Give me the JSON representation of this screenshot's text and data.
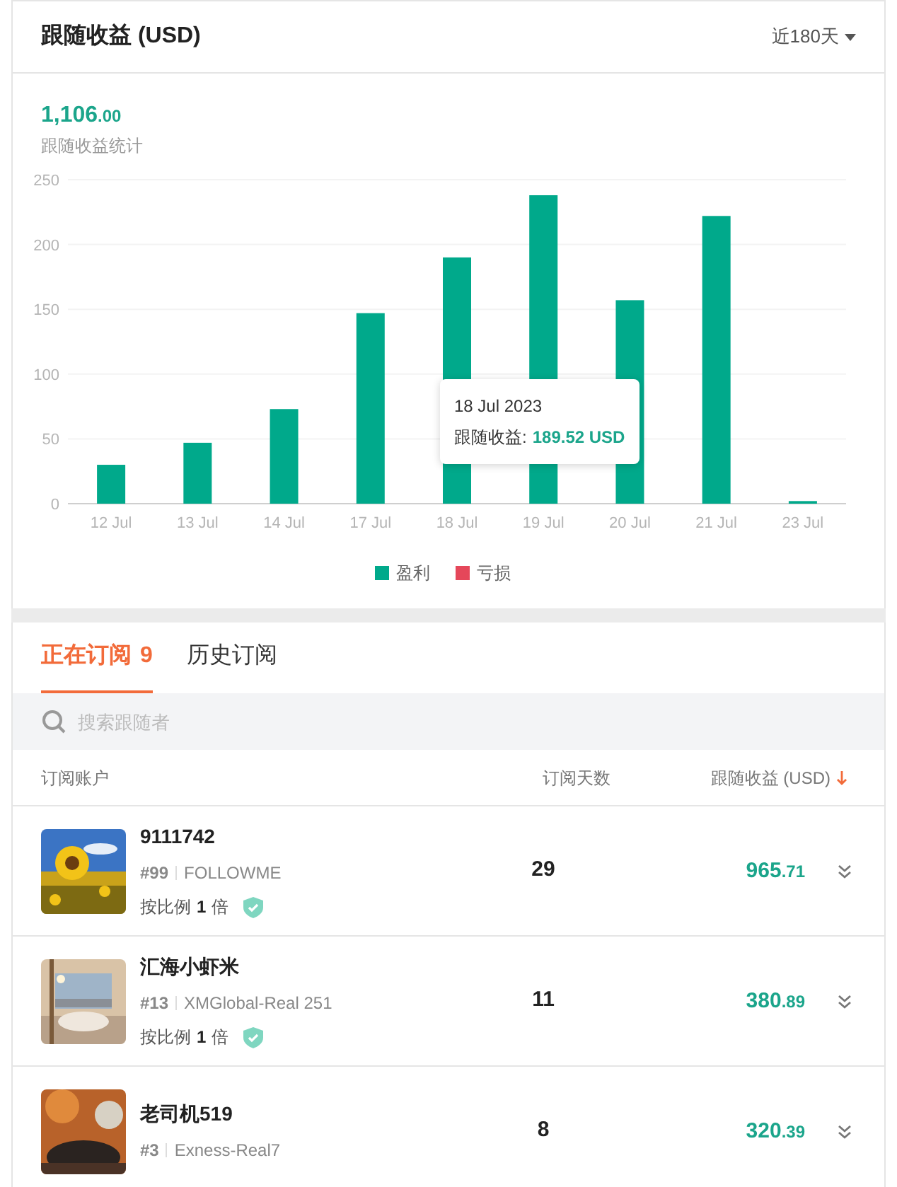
{
  "header": {
    "title": "跟随收益 (USD)",
    "period": "近180天"
  },
  "summary": {
    "total": "1,106.00",
    "label": "跟随收益统计"
  },
  "chart_data": {
    "type": "bar",
    "categories": [
      "12 Jul",
      "13 Jul",
      "14 Jul",
      "17 Jul",
      "18 Jul",
      "19 Jul",
      "20 Jul",
      "21 Jul",
      "23 Jul"
    ],
    "yticks": [
      0,
      50,
      100,
      150,
      200,
      250
    ],
    "ylim": [
      0,
      250
    ],
    "grid": true,
    "series": [
      {
        "name": "盈利",
        "color": "#00a98b",
        "values": [
          30,
          47,
          73,
          147,
          190,
          238,
          157,
          222,
          2
        ]
      },
      {
        "name": "亏损",
        "color": "#e5475a",
        "values": [
          null,
          null,
          null,
          null,
          null,
          null,
          null,
          null,
          null
        ]
      }
    ]
  },
  "tooltip": {
    "date": "18 Jul 2023",
    "label": "跟随收益:",
    "value": "189.52 USD"
  },
  "tabs": [
    {
      "label": "正在订阅",
      "count": "9",
      "selected": true
    },
    {
      "label": "历史订阅",
      "selected": false
    }
  ],
  "search": {
    "placeholder": "搜索跟随者"
  },
  "table": {
    "columns": [
      "订阅账户",
      "订阅天数",
      "跟随收益 (USD)"
    ],
    "rows": [
      {
        "name": "9111742",
        "rank": "#99",
        "account": "FOLLOWME",
        "ratio_label": "按比例",
        "ratio": "1",
        "ratio_unit": "倍",
        "days": "29",
        "earnings": "965.71"
      },
      {
        "name": "汇海小虾米",
        "rank": "#13",
        "account": "XMGlobal-Real 251",
        "ratio_label": "按比例",
        "ratio": "1",
        "ratio_unit": "倍",
        "days": "11",
        "earnings": "380.89"
      },
      {
        "name": "老司机519",
        "rank": "#3",
        "account": "Exness-Real7",
        "days": "8",
        "earnings": "320.39"
      }
    ]
  }
}
